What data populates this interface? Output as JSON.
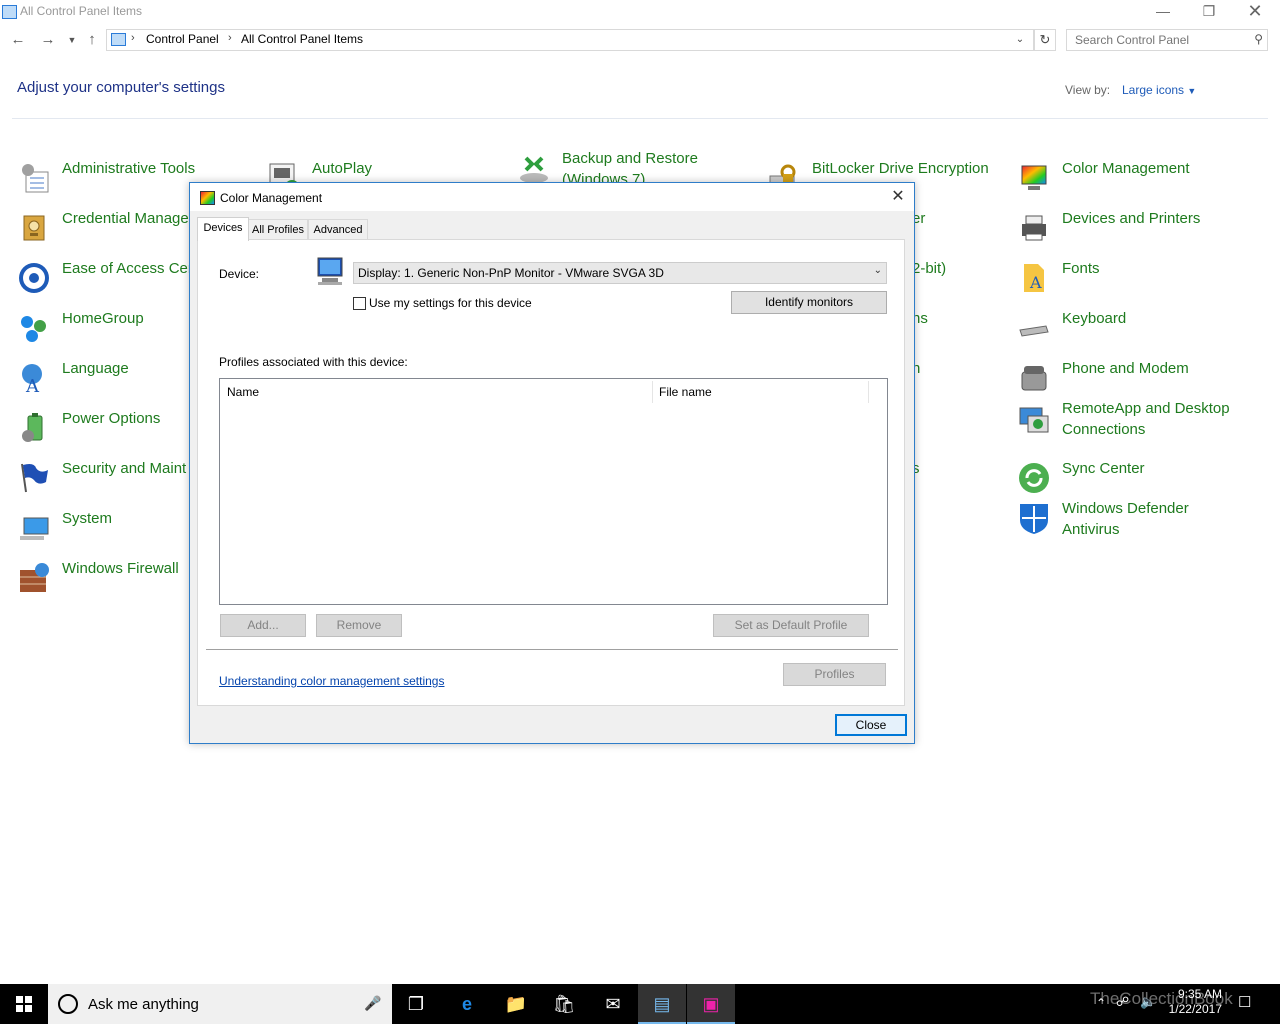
{
  "window": {
    "title": "All Control Panel Items"
  },
  "address": {
    "crumbs": [
      "Control Panel",
      "All Control Panel Items"
    ],
    "search_placeholder": "Search Control Panel"
  },
  "header": {
    "title": "Adjust your computer's settings",
    "view_by_label": "View by:",
    "view_by_value": "Large icons"
  },
  "items": {
    "col1": [
      {
        "label": "Administrative Tools",
        "icon": "admin-tools-icon"
      },
      {
        "label": "Credential Manage",
        "icon": "credential-manager-icon"
      },
      {
        "label": "Ease of Access Cer",
        "icon": "ease-of-access-icon"
      },
      {
        "label": "HomeGroup",
        "icon": "homegroup-icon"
      },
      {
        "label": "Language",
        "icon": "language-icon"
      },
      {
        "label": "Power Options",
        "icon": "power-options-icon"
      },
      {
        "label": "Security and Maint",
        "icon": "security-flag-icon"
      },
      {
        "label": "System",
        "icon": "system-icon"
      },
      {
        "label": "Windows Firewall",
        "icon": "firewall-icon"
      }
    ],
    "col2": [
      {
        "label": "AutoPlay",
        "icon": "autoplay-icon"
      }
    ],
    "col3": [
      {
        "label": "Backup and Restore",
        "label2": "(Windows 7)",
        "icon": "backup-icon"
      }
    ],
    "col4": [
      {
        "label": "BitLocker Drive Encryption",
        "icon": "bitlocker-icon"
      },
      {
        "label": "er"
      },
      {
        "label": "2-bit)"
      },
      {
        "label": "ns"
      },
      {
        "label": "n"
      },
      {
        "label": ""
      },
      {
        "label": "s"
      }
    ],
    "col5": [
      {
        "label": "Color Management",
        "icon": "color-management-icon"
      },
      {
        "label": "Devices and Printers",
        "icon": "printer-icon"
      },
      {
        "label": "Fonts",
        "icon": "fonts-icon"
      },
      {
        "label": "Keyboard",
        "icon": "keyboard-icon"
      },
      {
        "label": "Phone and Modem",
        "icon": "phone-icon"
      },
      {
        "label": "RemoteApp and Desktop",
        "label2": "Connections",
        "icon": "remoteapp-icon"
      },
      {
        "label": "Sync Center",
        "icon": "sync-icon"
      },
      {
        "label": "Windows Defender",
        "label2": "Antivirus",
        "icon": "defender-shield-icon"
      }
    ]
  },
  "dialog": {
    "title": "Color Management",
    "tabs": [
      "Devices",
      "All Profiles",
      "Advanced"
    ],
    "device_label": "Device:",
    "device_value": "Display: 1. Generic Non-PnP Monitor - VMware SVGA 3D",
    "use_my_settings": "Use my settings for this device",
    "identify_button": "Identify monitors",
    "profiles_label": "Profiles associated with this device:",
    "columns": [
      "Name",
      "File name"
    ],
    "add_button": "Add...",
    "remove_button": "Remove",
    "set_default_button": "Set as Default Profile",
    "understanding_link": "Understanding color management settings",
    "profiles_button": "Profiles",
    "close_button": "Close"
  },
  "taskbar": {
    "search_text": "Ask me anything",
    "time": "9:35 AM",
    "date": "1/22/2017",
    "watermark": "TheCollectionBook"
  },
  "colors": {
    "link_green": "#1e7b1e",
    "heading_blue": "#1e3287",
    "accent": "#0078d7"
  }
}
